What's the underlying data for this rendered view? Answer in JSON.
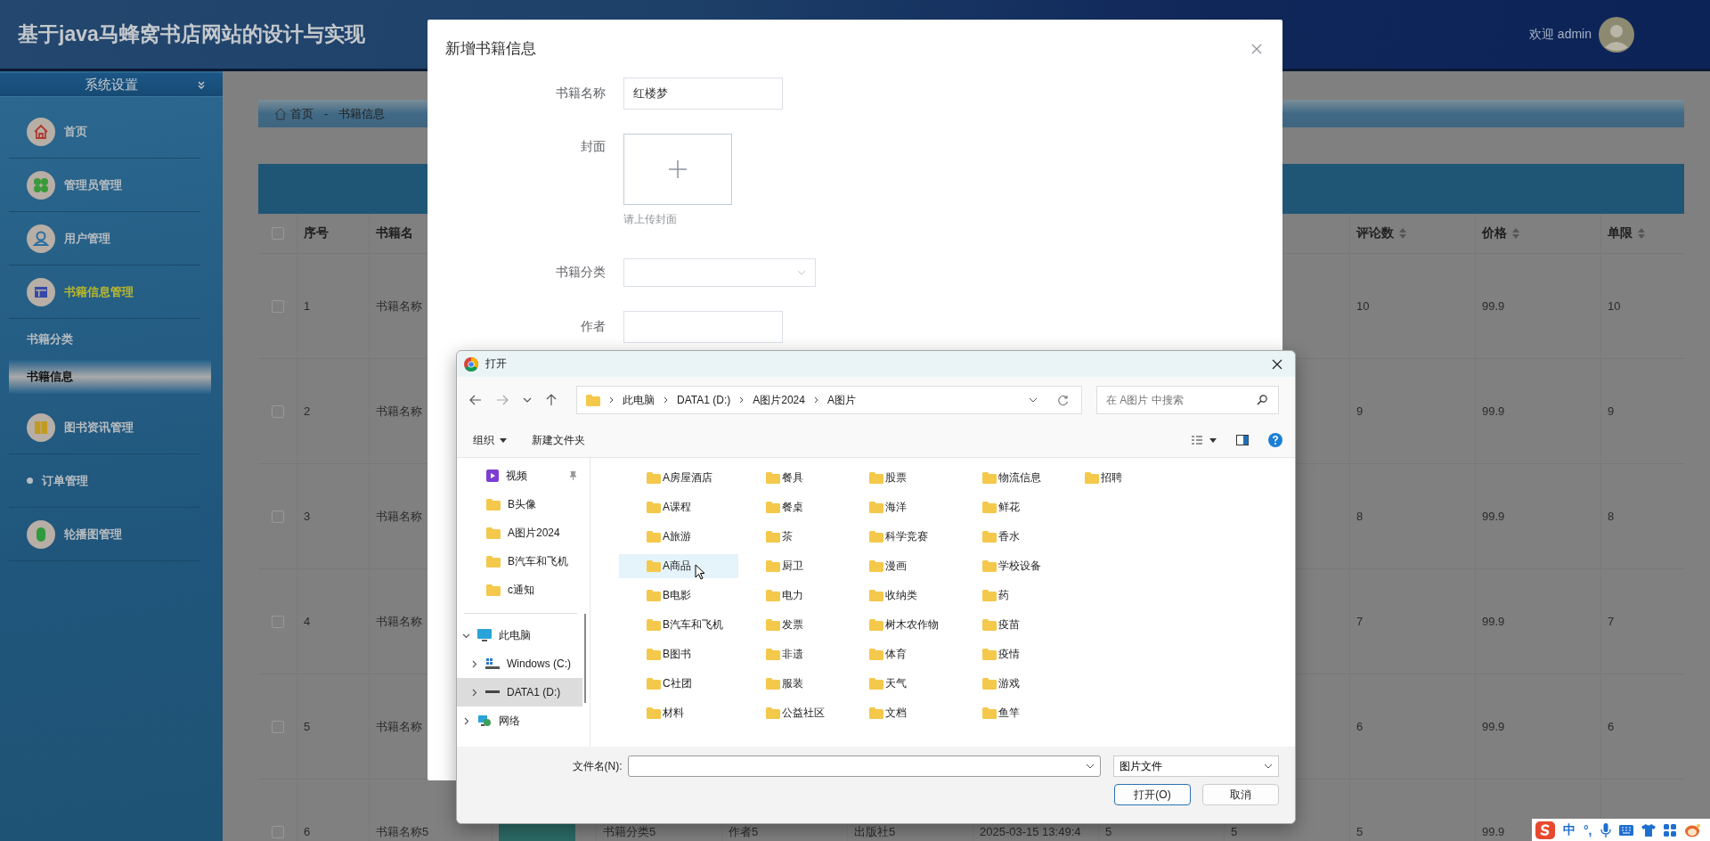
{
  "header": {
    "title": "基于java马蜂窝书店网站的设计与实现",
    "welcome": "欢迎 admin"
  },
  "sidebar": {
    "title": "系统设置",
    "items": [
      {
        "label": "首页",
        "kind": "icon",
        "expanded": false
      },
      {
        "label": "管理员管理",
        "kind": "icon",
        "expanded": false
      },
      {
        "label": "用户管理",
        "kind": "icon",
        "expanded": false
      },
      {
        "label": "书籍信息管理",
        "kind": "icon",
        "expanded": true,
        "children": [
          {
            "label": "书籍分类",
            "selected": false
          },
          {
            "label": "书籍信息",
            "selected": true
          }
        ]
      },
      {
        "label": "图书资讯管理",
        "kind": "icon",
        "expanded": false
      },
      {
        "label": "订单管理",
        "kind": "bullet",
        "expanded": false
      },
      {
        "label": "轮播图管理",
        "kind": "icon",
        "expanded": false
      }
    ]
  },
  "breadcrumb": {
    "items": [
      "首页",
      "书籍信息"
    ],
    "separator": "-"
  },
  "table": {
    "all_checked": false,
    "columns": [
      {
        "kind": "checkbox"
      },
      {
        "kind": "text",
        "label": "序号"
      },
      {
        "kind": "text",
        "label": "书籍名"
      },
      {
        "kind": "image"
      },
      {
        "kind": "text"
      },
      {
        "kind": "text"
      },
      {
        "kind": "text"
      },
      {
        "kind": "text"
      },
      {
        "kind": "text"
      },
      {
        "kind": "text"
      },
      {
        "kind": "text",
        "label": "评论数",
        "sortable": true
      },
      {
        "kind": "text",
        "label": "价格",
        "sortable": true
      },
      {
        "kind": "text",
        "label": "单限",
        "sortable": true
      }
    ],
    "rows": [
      {
        "checked": false,
        "cells": [
          null,
          "1",
          "书籍名称",
          null,
          null,
          null,
          null,
          null,
          null,
          null,
          "10",
          "99.9",
          "10"
        ]
      },
      {
        "checked": false,
        "cells": [
          null,
          "2",
          "书籍名称",
          null,
          null,
          null,
          null,
          null,
          null,
          null,
          "9",
          "99.9",
          "9"
        ]
      },
      {
        "checked": false,
        "cells": [
          null,
          "3",
          "书籍名称",
          null,
          null,
          null,
          null,
          null,
          null,
          null,
          "8",
          "99.9",
          "8"
        ]
      },
      {
        "checked": false,
        "cells": [
          null,
          "4",
          "书籍名称",
          null,
          null,
          null,
          null,
          null,
          null,
          null,
          "7",
          "99.9",
          "7"
        ]
      },
      {
        "checked": false,
        "cells": [
          null,
          "5",
          "书籍名称",
          null,
          null,
          null,
          null,
          null,
          null,
          null,
          "6",
          "99.9",
          "6"
        ]
      },
      {
        "checked": false,
        "cover": true,
        "cells": [
          null,
          "6",
          "书籍名称5",
          null,
          "书籍分类5",
          "作者5",
          "出版社5",
          "2025-03-15 13:49:4",
          "5",
          "5",
          "5",
          "99.9",
          null
        ]
      }
    ]
  },
  "dialog": {
    "title": "新增书籍信息",
    "fields": [
      {
        "kind": "input",
        "label": "书籍名称",
        "value": "红楼梦"
      },
      {
        "kind": "upload",
        "label": "封面",
        "hint": "请上传封面"
      },
      {
        "kind": "select",
        "label": "书籍分类"
      },
      {
        "kind": "input",
        "label": "作者"
      }
    ]
  },
  "file_dialog": {
    "title": "打开",
    "path": [
      "此电脑",
      "DATA1 (D:)",
      "A图片2024",
      "A图片"
    ],
    "search_placeholder": "在 A图片 中搜索",
    "toolbar": [
      "组织",
      "新建文件夹"
    ],
    "quick_access": [
      {
        "label": "视频",
        "kind": "video",
        "pinned": true
      },
      {
        "label": "B头像",
        "kind": "folder",
        "pinned": false
      },
      {
        "label": "A图片2024",
        "kind": "folder",
        "pinned": false
      },
      {
        "label": "B汽车和飞机",
        "kind": "folder",
        "pinned": false
      },
      {
        "label": "c通知",
        "kind": "folder",
        "pinned": false
      }
    ],
    "tree": [
      {
        "label": "此电脑",
        "kind": "pc",
        "expanded": true,
        "selected": false,
        "children": [
          {
            "label": "Windows (C:)",
            "kind": "drive-c",
            "expanded": false,
            "selected": false
          },
          {
            "label": "DATA1 (D:)",
            "kind": "drive-d",
            "expanded": false,
            "selected": true
          }
        ]
      },
      {
        "label": "网络",
        "kind": "network",
        "expanded": false,
        "selected": false
      }
    ],
    "folders": [
      {
        "name": "A房屋酒店",
        "hovered": false
      },
      {
        "name": "A课程",
        "hovered": false
      },
      {
        "name": "A旅游",
        "hovered": false
      },
      {
        "name": "A商品",
        "hovered": true
      },
      {
        "name": "B电影",
        "hovered": false
      },
      {
        "name": "B汽车和飞机",
        "hovered": false
      },
      {
        "name": "B图书",
        "hovered": false
      },
      {
        "name": "C社团",
        "hovered": false
      },
      {
        "name": "材料",
        "hovered": false
      },
      {
        "name": "餐具",
        "hovered": false
      },
      {
        "name": "餐桌",
        "hovered": false
      },
      {
        "name": "茶",
        "hovered": false
      },
      {
        "name": "厨卫",
        "hovered": false
      },
      {
        "name": "电力",
        "hovered": false
      },
      {
        "name": "发票",
        "hovered": false
      },
      {
        "name": "非遗",
        "hovered": false
      },
      {
        "name": "服装",
        "hovered": false
      },
      {
        "name": "公益社区",
        "hovered": false
      },
      {
        "name": "股票",
        "hovered": false
      },
      {
        "name": "海洋",
        "hovered": false
      },
      {
        "name": "科学竞赛",
        "hovered": false
      },
      {
        "name": "漫画",
        "hovered": false
      },
      {
        "name": "收纳类",
        "hovered": false
      },
      {
        "name": "树木农作物",
        "hovered": false
      },
      {
        "name": "体育",
        "hovered": false
      },
      {
        "name": "天气",
        "hovered": false
      },
      {
        "name": "文档",
        "hovered": false
      },
      {
        "name": "物流信息",
        "hovered": false
      },
      {
        "name": "鲜花",
        "hovered": false
      },
      {
        "name": "香水",
        "hovered": false
      },
      {
        "name": "学校设备",
        "hovered": false
      },
      {
        "name": "药",
        "hovered": false
      },
      {
        "name": "疫苗",
        "hovered": false
      },
      {
        "name": "疫情",
        "hovered": false
      },
      {
        "name": "游戏",
        "hovered": false
      },
      {
        "name": "鱼竿",
        "hovered": false
      },
      {
        "name": "招聘",
        "hovered": false
      }
    ],
    "filename_label": "文件名(N):",
    "filetype": "图片文件",
    "buttons": [
      {
        "label": "打开(O)",
        "primary": true
      },
      {
        "label": "取消",
        "primary": false
      }
    ]
  },
  "ime": {
    "language": "中",
    "punctuation": "°,"
  }
}
